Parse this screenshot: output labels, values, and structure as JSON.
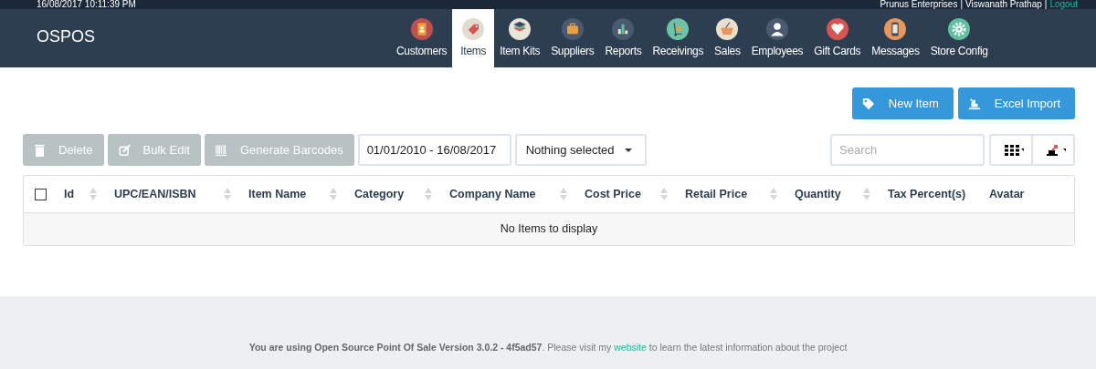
{
  "top_bar": {
    "datetime": "16/08/2017 10:11:39 PM",
    "user_info": [
      "Prunus Enterprises",
      "|",
      "Viswanath Prathap",
      "|"
    ],
    "logout": "Logout"
  },
  "brand": "OSPOS",
  "nav": [
    {
      "label": "Customers",
      "color": "#c0504d",
      "selected": false
    },
    {
      "label": "Items",
      "color": "#e0ddd0",
      "selected": true
    },
    {
      "label": "Item Kits",
      "color": "#e8e4d8",
      "selected": false
    },
    {
      "label": "Suppliers",
      "color": "#4a5a70",
      "selected": false
    },
    {
      "label": "Reports",
      "color": "#4a5a70",
      "selected": false
    },
    {
      "label": "Receivings",
      "color": "#6cc3a5",
      "selected": false
    },
    {
      "label": "Sales",
      "color": "#e8e0cc",
      "selected": false
    },
    {
      "label": "Employees",
      "color": "#4a5a70",
      "selected": false
    },
    {
      "label": "Gift Cards",
      "color": "#d9534f",
      "selected": false
    },
    {
      "label": "Messages",
      "color": "#e8965a",
      "selected": false
    },
    {
      "label": "Store Config",
      "color": "#5fbf9f",
      "selected": false
    }
  ],
  "actions": [
    {
      "label": "New Item"
    },
    {
      "label": "Excel Import"
    }
  ],
  "toolbar": {
    "buttons": [
      {
        "label": "Delete",
        "disabled": true
      },
      {
        "label": "Bulk Edit",
        "disabled": true
      },
      {
        "label": "Generate Barcodes",
        "disabled": true
      }
    ],
    "date_range": "01/01/2010 - 16/08/2017",
    "filter": "Nothing selected",
    "search": {
      "placeholder": "Search"
    }
  },
  "table": {
    "select_all": {
      "checked": false
    },
    "columns": [
      {
        "label": "Id",
        "sortable": true
      },
      {
        "label": "UPC/EAN/ISBN",
        "sortable": true
      },
      {
        "label": "Item Name",
        "sortable": true
      },
      {
        "label": "Category",
        "sortable": true
      },
      {
        "label": "Company Name",
        "sortable": true
      },
      {
        "label": "Cost Price",
        "sortable": true
      },
      {
        "label": "Retail Price",
        "sortable": true
      },
      {
        "label": "Quantity",
        "sortable": true
      },
      {
        "label": "Tax Percent(s)",
        "sortable": false
      },
      {
        "label": "Avatar",
        "sortable": false
      }
    ],
    "empty_message": "No Items to display"
  },
  "footer": {
    "before": "**You are using Open Source Point Of Sale Version 3.0.2 - 4f5ad57**. Please visit my",
    "link": "website",
    "after": "to learn the latest information about the project"
  }
}
